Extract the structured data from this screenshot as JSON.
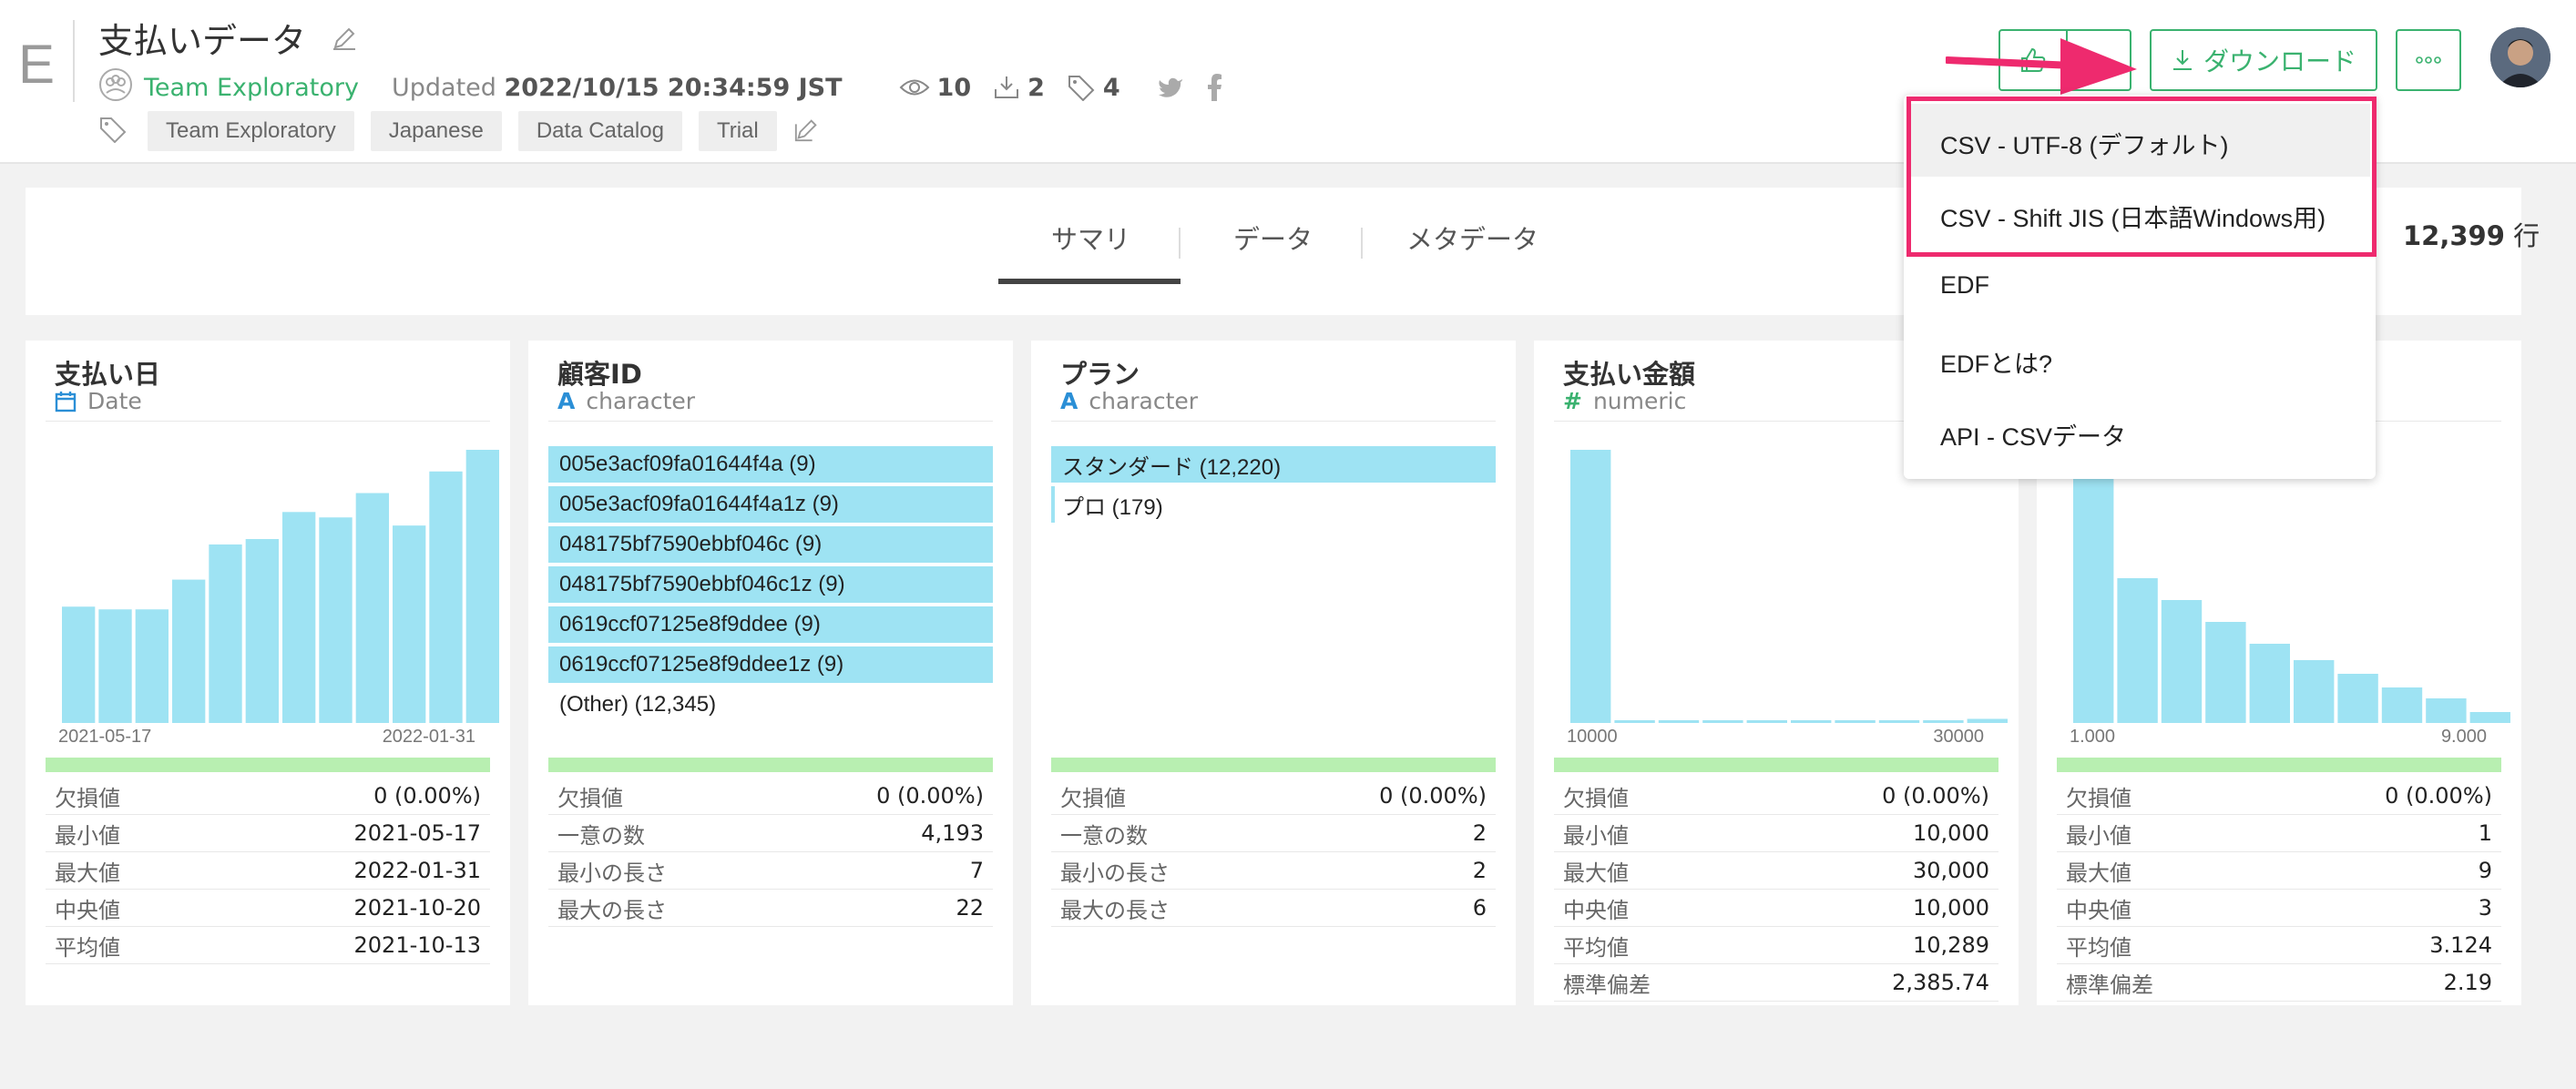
{
  "app": {
    "logo_letter": "E"
  },
  "page": {
    "title": "支払いデータ",
    "team": "Team Exploratory",
    "updated_label": "Updated",
    "updated_value": "2022/10/15 20:34:59 JST",
    "views": "10",
    "downloads": "2",
    "tags_count": "4",
    "tags": [
      "Team Exploratory",
      "Japanese",
      "Data Catalog",
      "Trial"
    ]
  },
  "toolbar": {
    "download_label": "ダウンロード"
  },
  "tabs": [
    {
      "label": "サマリ",
      "active": true
    },
    {
      "label": "データ"
    },
    {
      "label": "メタデータ"
    }
  ],
  "row_count": {
    "value": "12,399",
    "unit": "行"
  },
  "dropdown": {
    "items": [
      "CSV - UTF-8 (デフォルト)",
      "CSV - Shift JIS (日本語Windows用)",
      "EDF",
      "EDFとは?",
      "API - CSVデータ"
    ]
  },
  "colors": {
    "accent": "#3ab26f",
    "bar": "#9ee3f3",
    "highlight": "#ee2a6e",
    "green_bar": "#b8efb1"
  },
  "cards": [
    {
      "title": "支払い日",
      "type": "Date",
      "type_icon": "calendar-icon",
      "axis_min": "2021-05-17",
      "axis_max": "2022-01-31",
      "histogram": [
        43,
        42,
        42,
        53,
        66,
        68,
        78,
        76,
        85,
        73,
        93,
        101
      ],
      "stats": [
        [
          "欠損値",
          "0 (0.00%)"
        ],
        [
          "最小値",
          "2021-05-17"
        ],
        [
          "最大値",
          "2022-01-31"
        ],
        [
          "中央値",
          "2021-10-20"
        ],
        [
          "平均値",
          "2021-10-13"
        ]
      ]
    },
    {
      "title": "顧客ID",
      "type": "character",
      "type_icon": "text-type-icon",
      "values": [
        {
          "label": "005e3acf09fa01644f4a (9)",
          "ratio": 1
        },
        {
          "label": "005e3acf09fa01644f4a1z (9)",
          "ratio": 1
        },
        {
          "label": "048175bf7590ebbf046c (9)",
          "ratio": 1
        },
        {
          "label": "048175bf7590ebbf046c1z (9)",
          "ratio": 1
        },
        {
          "label": "0619ccf07125e8f9ddee (9)",
          "ratio": 1
        },
        {
          "label": "0619ccf07125e8f9ddee1z (9)",
          "ratio": 1
        },
        {
          "label": "(Other) (12,345)",
          "ratio": 0
        }
      ],
      "stats": [
        [
          "欠損値",
          "0 (0.00%)"
        ],
        [
          "一意の数",
          "4,193"
        ],
        [
          "最小の長さ",
          "7"
        ],
        [
          "最大の長さ",
          "22"
        ]
      ]
    },
    {
      "title": "プラン",
      "type": "character",
      "type_icon": "text-type-icon",
      "values": [
        {
          "label": "スタンダード (12,220)",
          "ratio": 1
        },
        {
          "label": "プロ (179)",
          "ratio": 0.015
        }
      ],
      "stats": [
        [
          "欠損値",
          "0 (0.00%)"
        ],
        [
          "一意の数",
          "2"
        ],
        [
          "最小の長さ",
          "2"
        ],
        [
          "最大の長さ",
          "6"
        ]
      ]
    },
    {
      "title": "支払い金額",
      "type": "numeric",
      "type_icon": "hash-icon",
      "axis_min": "10000",
      "axis_max": "30000",
      "histogram": [
        100,
        1,
        1,
        1,
        1,
        1,
        1,
        1,
        1,
        1.5
      ],
      "stats": [
        [
          "欠損値",
          "0 (0.00%)"
        ],
        [
          "最小値",
          "10,000"
        ],
        [
          "最大値",
          "30,000"
        ],
        [
          "中央値",
          "10,000"
        ],
        [
          "平均値",
          "10,289"
        ],
        [
          "標準偏差",
          "2,385.74"
        ]
      ]
    },
    {
      "title": "",
      "type": "",
      "type_icon": "hash-icon",
      "axis_min": "1.000",
      "axis_max": "9.000",
      "histogram": [
        100,
        53,
        45,
        37,
        29,
        23,
        18,
        13,
        9,
        4
      ],
      "stats": [
        [
          "欠損値",
          "0 (0.00%)"
        ],
        [
          "最小値",
          "1"
        ],
        [
          "最大値",
          "9"
        ],
        [
          "中央値",
          "3"
        ],
        [
          "平均値",
          "3.124"
        ],
        [
          "標準偏差",
          "2.19"
        ]
      ]
    }
  ]
}
